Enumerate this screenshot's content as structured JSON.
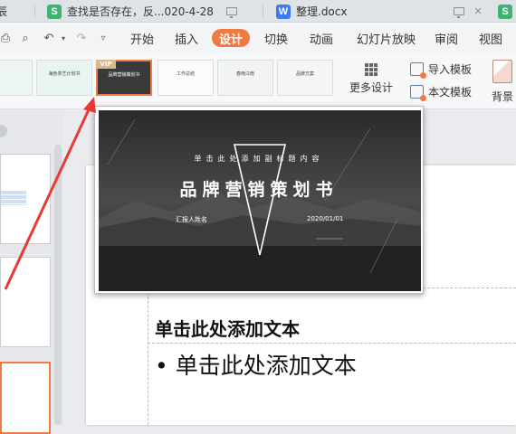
{
  "tabs": [
    {
      "label": "辰",
      "type": "s"
    },
    {
      "label": "查找是否存在，反...020-4-28",
      "type": "s"
    },
    {
      "label": "整理.docx",
      "type": "w"
    }
  ],
  "menu": {
    "items": [
      "开始",
      "插入",
      "设计",
      "切换",
      "动画",
      "幻灯片放映",
      "审阅",
      "视图"
    ],
    "active": "设计"
  },
  "ribbon": {
    "vip_badge": "VIP",
    "thumbs": [
      "",
      "海色茶艺计划书",
      "品牌营销策划书",
      "工作总结",
      "春雨江南",
      "品牌方案"
    ],
    "more_label": "更多设计",
    "import_label": "导入模板",
    "text_label": "本文模板",
    "background_label": "背景"
  },
  "preview": {
    "subtitle": "单击此处添加副标题内容",
    "title": "品牌营销策划书",
    "reporter": "汇报人姓名",
    "date": "2020/01/01"
  },
  "slide": {
    "title": "单击此处添加文本",
    "body": "• 单击此处添加文本"
  }
}
